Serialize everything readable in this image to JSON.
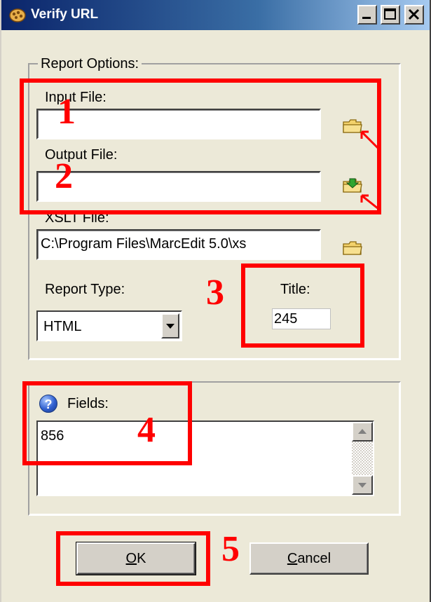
{
  "window": {
    "title": "Verify URL",
    "controls": {
      "minimize": "minimize",
      "maximize": "maximize",
      "close": "close"
    }
  },
  "report_options": {
    "legend": "Report Options:",
    "input_file": {
      "label": "Input File:",
      "value": ""
    },
    "output_file": {
      "label": "Output File:",
      "value": ""
    },
    "xslt_file": {
      "label": "XSLT File:",
      "value": "C:\\Program Files\\MarcEdit 5.0\\xs"
    },
    "report_type": {
      "label": "Report Type:",
      "selected": "HTML"
    },
    "title_field": {
      "label": "Title:",
      "value": "245"
    }
  },
  "fields": {
    "label": "Fields:",
    "value": "856"
  },
  "buttons": {
    "ok": "OK",
    "ok_mnemonic": "O",
    "ok_rest": "K",
    "cancel": "Cancel",
    "cancel_mnemonic": "C",
    "cancel_rest": "ancel"
  },
  "annotations": [
    "1",
    "2",
    "3",
    "4",
    "5"
  ],
  "colors": {
    "highlight": "#ff0000",
    "titlebar": "#0a246a",
    "dialog_bg": "#ece9d8"
  },
  "icons": {
    "app": "plugin-icon",
    "input_browse": "folder-icon",
    "output_browse": "folder-save-icon",
    "xslt_browse": "folder-icon",
    "help": "help-icon"
  }
}
